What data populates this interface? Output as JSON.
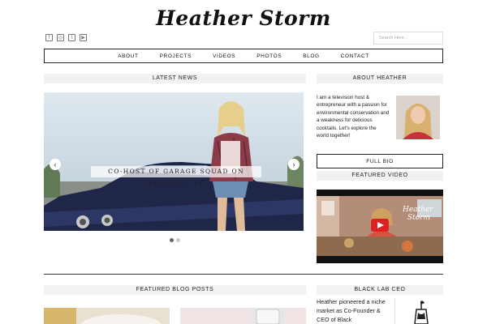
{
  "site": {
    "logo": "Heather Storm"
  },
  "social": [
    {
      "name": "facebook-icon",
      "glyph": "f"
    },
    {
      "name": "instagram-icon",
      "glyph": "◎"
    },
    {
      "name": "twitter-icon",
      "glyph": "t"
    },
    {
      "name": "youtube-icon",
      "glyph": "▶"
    }
  ],
  "search": {
    "placeholder": "Search Here..."
  },
  "nav": [
    "ABOUT",
    "PROJECTS",
    "VIDEOS",
    "PHOTOS",
    "BLOG",
    "CONTACT"
  ],
  "sections": {
    "latest_news": "LATEST NEWS",
    "about": "ABOUT HEATHER",
    "featured_video": "FEATURED VIDEO",
    "featured_blog": "FEATURED BLOG POSTS",
    "black_lab": "BLACK LAB CEO"
  },
  "slider": {
    "caption": "CO-HOST OF GARAGE SQUAD ON VELOCITY TV",
    "prev_glyph": "‹",
    "next_glyph": "›",
    "active_dot": 0
  },
  "about": {
    "text": "I am a television host & entrepreneur with a passion for environmental conservation and a weakness for delicious cocktails. Let's explore the world together!",
    "button": "FULL BIO"
  },
  "video": {
    "logo_line1": "Heather",
    "logo_line2": "Storm"
  },
  "black_lab": {
    "text": "Heather pioneered a niche market as Co-Founder & CEO of Black"
  },
  "colors": {
    "accent": "#222222",
    "section_bg": "#f2f2f2",
    "play_button": "#e02020"
  }
}
